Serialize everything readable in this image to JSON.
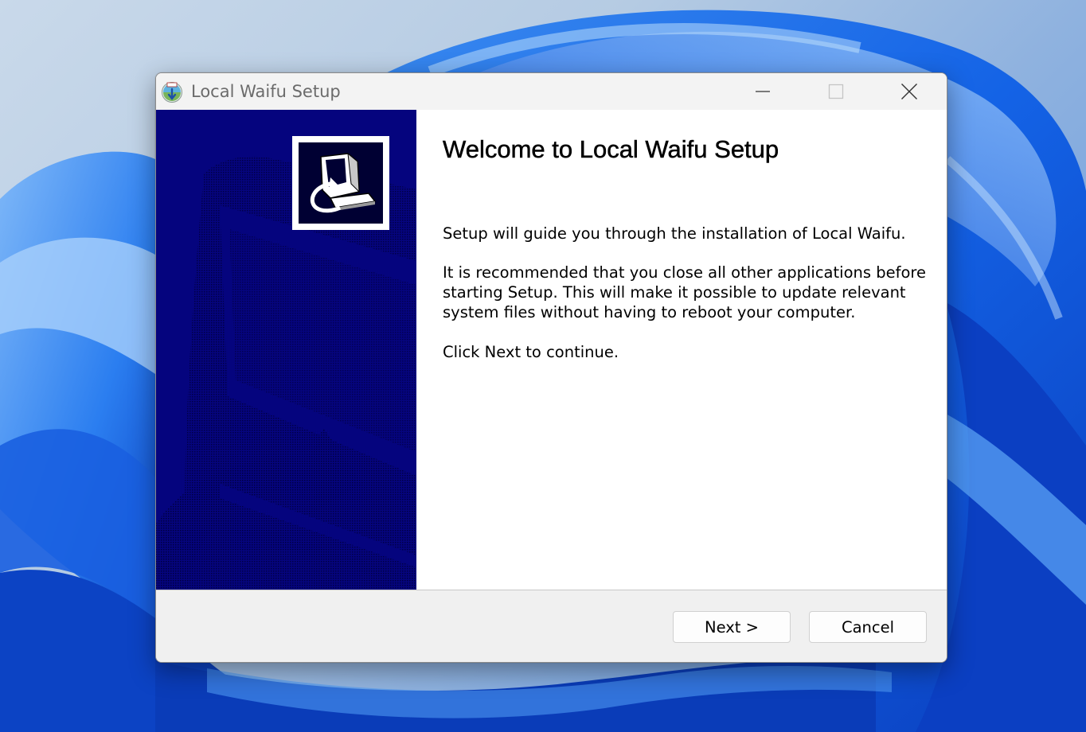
{
  "window": {
    "title": "Local Waifu Setup",
    "controls": {
      "minimize_icon": "minimize-icon",
      "maximize_icon": "maximize-icon",
      "close_icon": "close-icon"
    }
  },
  "banner": {
    "logo_icon": "installer-computer-icon",
    "background_color": "#05047e"
  },
  "content": {
    "heading": "Welcome to Local Waifu Setup",
    "paragraphs": {
      "intro": "Setup will guide you through the installation of Local Waifu.",
      "recommend": "It is recommended that you close all other applications before starting Setup. This will make it possible to update relevant system files without having to reboot your computer.",
      "continue": "Click Next to continue."
    }
  },
  "footer": {
    "next_label": "Next >",
    "cancel_label": "Cancel"
  },
  "colors": {
    "accent_blue": "#1f5fe0",
    "banner_navy": "#05047e"
  }
}
